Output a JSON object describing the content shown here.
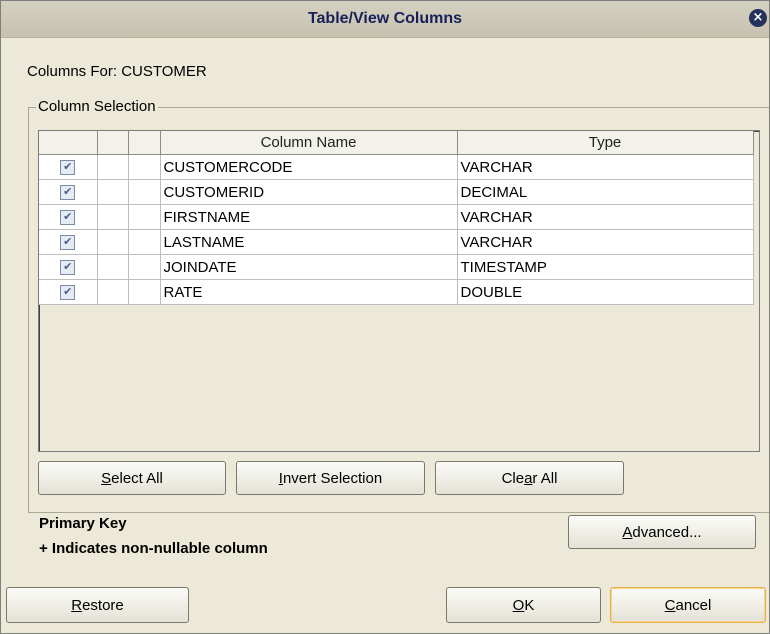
{
  "window": {
    "title": "Table/View Columns"
  },
  "columns_for": "Columns For: CUSTOMER",
  "group": {
    "title": "Column Selection"
  },
  "table": {
    "headers": [
      "",
      "",
      "",
      "Column Name",
      "Type"
    ],
    "rows": [
      {
        "checked": true,
        "name": "CUSTOMERCODE",
        "type": "VARCHAR"
      },
      {
        "checked": true,
        "name": "CUSTOMERID",
        "type": "DECIMAL"
      },
      {
        "checked": true,
        "name": "FIRSTNAME",
        "type": "VARCHAR"
      },
      {
        "checked": true,
        "name": "LASTNAME",
        "type": "VARCHAR"
      },
      {
        "checked": true,
        "name": "JOINDATE",
        "type": "TIMESTAMP"
      },
      {
        "checked": true,
        "name": "RATE",
        "type": "DOUBLE"
      }
    ]
  },
  "buttons": {
    "select_all": {
      "pre": "",
      "mn": "S",
      "post": "elect All"
    },
    "invert": {
      "pre": "",
      "mn": "I",
      "post": "nvert Selection"
    },
    "clear_all": {
      "pre": "Cle",
      "mn": "a",
      "post": "r All"
    },
    "advanced": {
      "pre": "",
      "mn": "A",
      "post": "dvanced..."
    },
    "restore": {
      "pre": "",
      "mn": "R",
      "post": "estore"
    },
    "ok": {
      "pre": "",
      "mn": "O",
      "post": "K"
    },
    "cancel": {
      "pre": "",
      "mn": "C",
      "post": "ancel"
    }
  },
  "legend": {
    "primary_key": "Primary Key",
    "non_nullable": "+ Indicates non-nullable column"
  }
}
